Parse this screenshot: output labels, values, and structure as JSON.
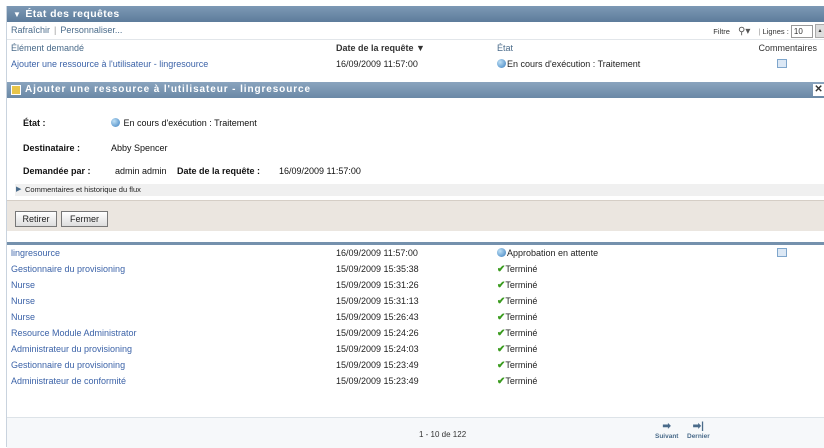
{
  "header": {
    "title": "État des requêtes"
  },
  "toolbar": {
    "refresh": "Rafraîchir",
    "customize": "Personnaliser...",
    "filter": "Filtre",
    "lines_label": "Lignes :",
    "lines_value": "10"
  },
  "columns": {
    "item": "Élément demandé",
    "date": "Date de la requête ▼",
    "state": "État",
    "comments": "Commentaires"
  },
  "top_row": {
    "item": "Ajouter une ressource à l'utilisateur - lingresource",
    "date": "16/09/2009 11:57:00",
    "state": "En cours d'exécution : Traitement"
  },
  "detail": {
    "title": "Ajouter une ressource à l'utilisateur - lingresource",
    "state_label": "État :",
    "state_value": "En cours d'exécution : Traitement",
    "recipient_label": "Destinataire :",
    "recipient_value": "Abby Spencer",
    "requested_by_label": "Demandée par :",
    "requested_by_value": "admin admin",
    "request_date_label": "Date de la requête :",
    "request_date_value": "16/09/2009 11:57:00",
    "flux": "Commentaires et historique du flux",
    "retract": "Retirer",
    "close": "Fermer"
  },
  "rows": [
    {
      "item": "lingresource",
      "date": "16/09/2009 11:57:00",
      "state": "Approbation en attente",
      "status": "pending",
      "comment": true
    },
    {
      "item": "Gestionnaire du provisioning",
      "date": "15/09/2009 15:35:38",
      "state": "Terminé",
      "status": "done"
    },
    {
      "item": "Nurse",
      "date": "15/09/2009 15:31:26",
      "state": "Terminé",
      "status": "done"
    },
    {
      "item": "Nurse",
      "date": "15/09/2009 15:31:13",
      "state": "Terminé",
      "status": "done"
    },
    {
      "item": "Nurse",
      "date": "15/09/2009 15:26:43",
      "state": "Terminé",
      "status": "done"
    },
    {
      "item": "Resource Module Administrator",
      "date": "15/09/2009 15:24:26",
      "state": "Terminé",
      "status": "done"
    },
    {
      "item": "Administrateur du provisioning",
      "date": "15/09/2009 15:24:03",
      "state": "Terminé",
      "status": "done"
    },
    {
      "item": "Gestionnaire du provisioning",
      "date": "15/09/2009 15:23:49",
      "state": "Terminé",
      "status": "done"
    },
    {
      "item": "Administrateur de conformité",
      "date": "15/09/2009 15:23:49",
      "state": "Terminé",
      "status": "done"
    }
  ],
  "footer": {
    "pagination": "1 - 10 de 122",
    "next": "Suivant",
    "last": "Dernier"
  },
  "colors": {
    "header": "#5d7c9b",
    "link": "#3c63a8",
    "done": "#3a9b1e"
  }
}
